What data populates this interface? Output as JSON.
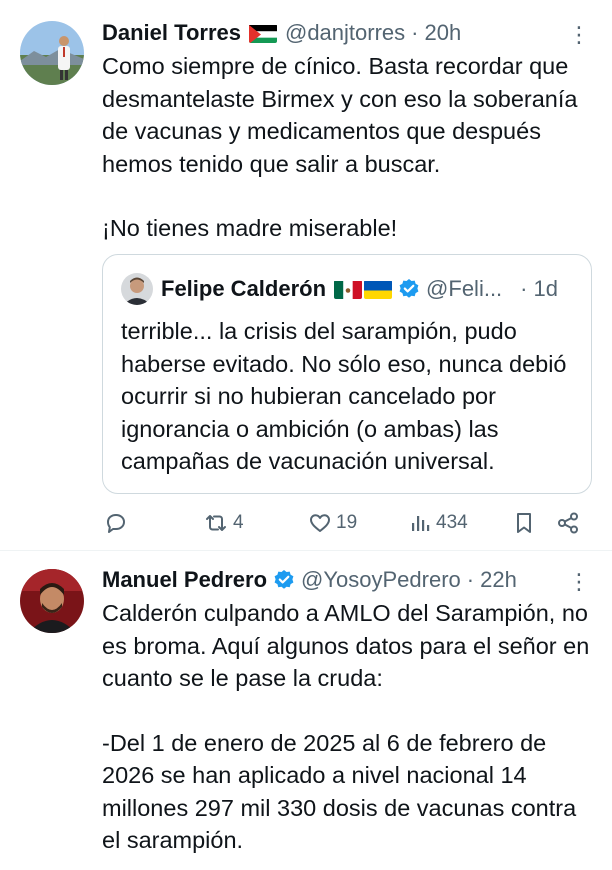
{
  "tweet1": {
    "name": "Daniel Torres",
    "handle": "@danjtorres",
    "separator": "·",
    "time": "20h",
    "more": "⋮",
    "text_p1": "Como siempre de cínico. Basta recordar que desmantelaste Birmex y con eso la soberanía de vacunas y medicamentos que después hemos tenido que salir a buscar.",
    "text_p2": "¡No tienes madre miserable!",
    "quote": {
      "name": "Felipe Calderón",
      "handle": "@Feli...",
      "separator": "·",
      "time": "1d",
      "text": "terrible... la crisis del sarampión, pudo haberse evitado. No sólo eso, nunca debió ocurrir si no hubieran cancelado por ignorancia o ambición (o ambas) las campañas  de vacunación universal."
    },
    "actions": {
      "reply_count": "",
      "retweet_count": "4",
      "like_count": "19",
      "view_count": "434"
    }
  },
  "tweet2": {
    "name": "Manuel Pedrero",
    "handle": "@YosoyPedrero",
    "separator": "·",
    "time": "22h",
    "more": "⋮",
    "text_p1": "Calderón culpando a AMLO del Sarampión, no es broma. Aquí algunos datos para el señor en cuanto se le pase la cruda:",
    "text_p2": "-Del 1 de enero de 2025 al 6 de febrero de 2026 se han aplicado a nivel nacional 14 millones 297 mil 330 dosis de vacunas contra el sarampión."
  },
  "colors": {
    "text": "#0f1419",
    "secondary": "#536471",
    "verified": "#1d9bf0",
    "border": "#cfd9de"
  }
}
